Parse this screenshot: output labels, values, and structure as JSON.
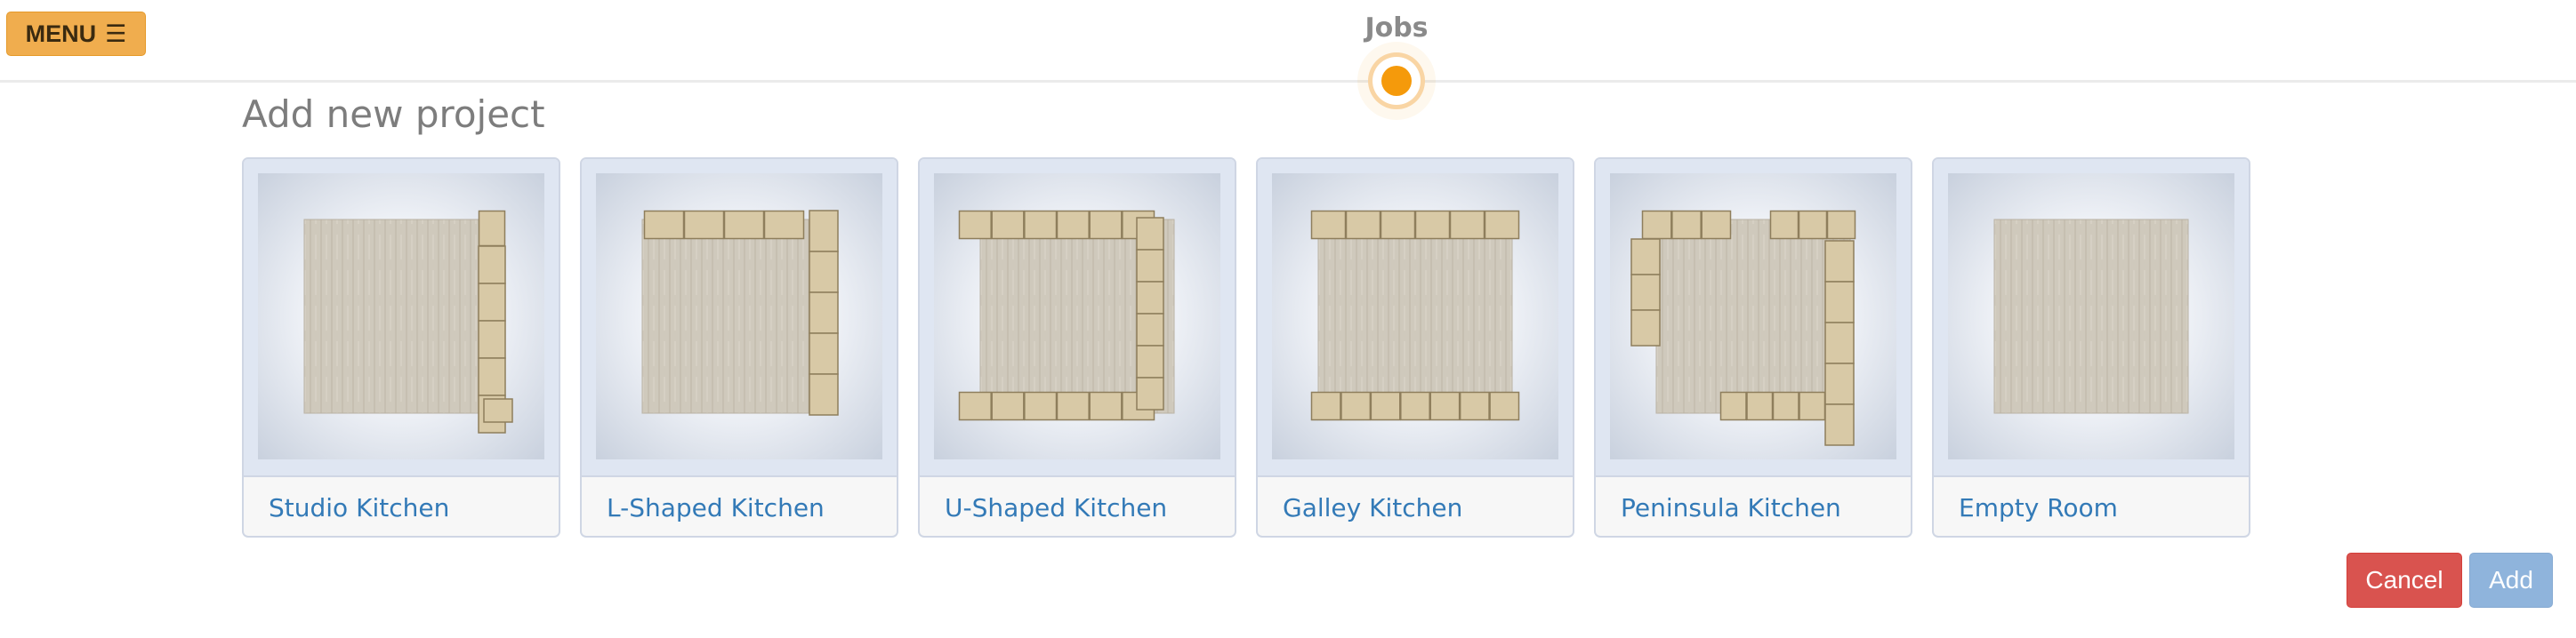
{
  "header": {
    "menu_label": "MENU",
    "menu_icon": "☰",
    "title": "Jobs"
  },
  "main": {
    "heading": "Add new project",
    "templates": [
      {
        "label": "Studio Kitchen",
        "layout": "studio"
      },
      {
        "label": "L-Shaped Kitchen",
        "layout": "l-shaped"
      },
      {
        "label": "U-Shaped Kitchen",
        "layout": "u-shaped"
      },
      {
        "label": "Galley Kitchen",
        "layout": "galley"
      },
      {
        "label": "Peninsula Kitchen",
        "layout": "peninsula"
      },
      {
        "label": "Empty Room",
        "layout": "empty"
      }
    ]
  },
  "footer": {
    "cancel_label": "Cancel",
    "add_label": "Add"
  },
  "colors": {
    "menu": "#f0ad4e",
    "link": "#337ab7",
    "cancel": "#d9534f",
    "add": "#8fb4dc",
    "indicator": "#f59a0b"
  }
}
